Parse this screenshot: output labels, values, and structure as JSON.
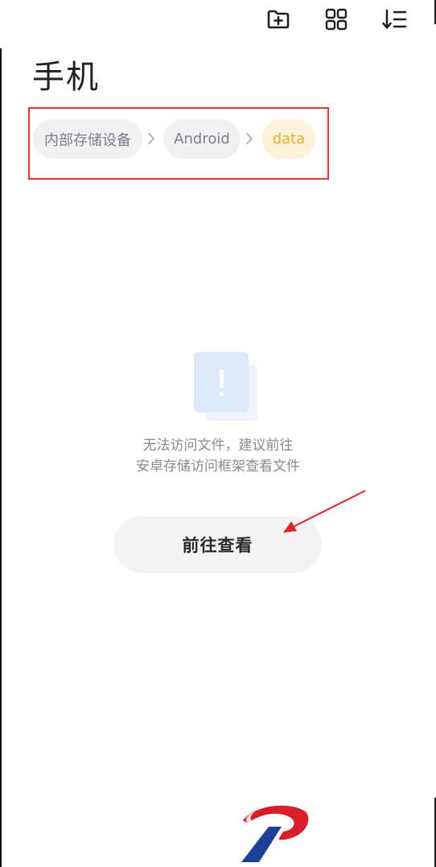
{
  "header": {
    "title": "手机",
    "actions": [
      {
        "name": "new-folder",
        "icon": "folder-plus-icon"
      },
      {
        "name": "grid-view",
        "icon": "grid-icon"
      },
      {
        "name": "sort",
        "icon": "sort-icon"
      }
    ]
  },
  "breadcrumb": {
    "items": [
      {
        "label": "内部存储设备",
        "active": false
      },
      {
        "label": "Android",
        "active": false
      },
      {
        "label": "data",
        "active": true
      }
    ],
    "highlight_color": "#e03a3a"
  },
  "empty_state": {
    "icon": "exclamation-document-icon",
    "line1": "无法访问文件，建议前往",
    "line2": "安卓存储访问框架查看文件",
    "button_label": "前往查看"
  },
  "colors": {
    "accent": "#e7b02e",
    "annotation": "#e03a3a",
    "muted_text": "#8a8a8a"
  }
}
